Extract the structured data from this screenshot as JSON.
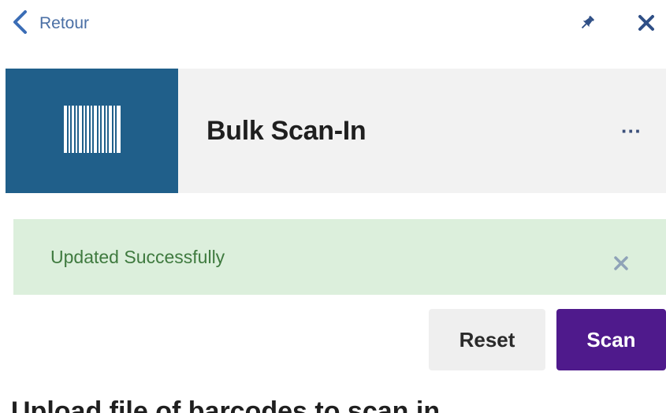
{
  "nav": {
    "back_label": "Retour"
  },
  "header": {
    "title": "Bulk Scan-In",
    "more_label": "···"
  },
  "banner": {
    "message": "Updated Successfully"
  },
  "actions": {
    "reset_label": "Reset",
    "scan_label": "Scan"
  },
  "section": {
    "heading": "Upload file of barcodes to scan in"
  },
  "icons": {
    "back": "chevron-left-icon",
    "pin": "pin-icon",
    "close": "close-icon",
    "barcode": "barcode-icon",
    "more": "ellipsis-icon",
    "dismiss": "close-icon"
  },
  "colors": {
    "accent": "#205f8a",
    "primary_button": "#4f1a8c",
    "success_bg": "#dcefdc",
    "success_text": "#3f7a3f",
    "link": "#3b6db6"
  }
}
